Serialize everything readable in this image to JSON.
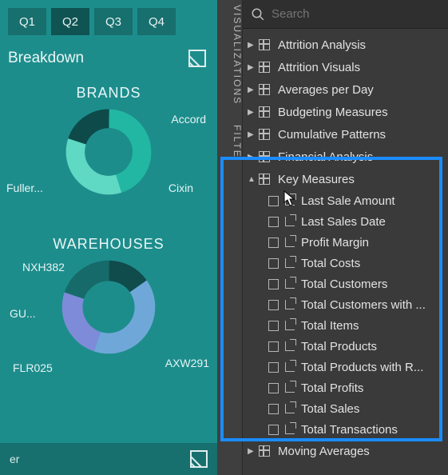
{
  "report": {
    "tabs": [
      "Q1",
      "Q2",
      "Q3",
      "Q4"
    ],
    "active_tab_index": 1,
    "breakdown_label": "Breakdown",
    "footer_label": "er",
    "brands": {
      "title": "BRANDS",
      "labels": {
        "top_right": "Accord",
        "left": "Fuller...",
        "bottom_right": "Cixin"
      }
    },
    "warehouses": {
      "title": "WAREHOUSES",
      "labels": {
        "top_left": "NXH382",
        "left": "GU...",
        "bottom_left": "FLR025",
        "bottom_right": "AXW291"
      }
    }
  },
  "chart_data": [
    {
      "type": "pie",
      "title": "BRANDS",
      "subtype": "donut",
      "series": [
        {
          "name": "Accord",
          "value": 45
        },
        {
          "name": "Cixin",
          "value": 35
        },
        {
          "name": "Fuller...",
          "value": 20
        }
      ]
    },
    {
      "type": "pie",
      "title": "WAREHOUSES",
      "subtype": "donut",
      "series": [
        {
          "name": "AXW291",
          "value": 40
        },
        {
          "name": "NXH382",
          "value": 25
        },
        {
          "name": "GU...",
          "value": 20
        },
        {
          "name": "FLR025",
          "value": 15
        }
      ]
    }
  ],
  "fields_panel": {
    "vertical_labels": {
      "top": "VISUALIZATIONS",
      "bottom": "FILTE"
    },
    "search_placeholder": "Search",
    "tables": [
      "Attrition Analysis",
      "Attrition Visuals",
      "Averages per Day",
      "Budgeting Measures",
      "Cumulative Patterns",
      "Financial Analysis"
    ],
    "expanded_table": "Key Measures",
    "measures": [
      "Last Sale Amount",
      "Last Sales Date",
      "Profit Margin",
      "Total Costs",
      "Total Customers",
      "Total Customers with ...",
      "Total Items",
      "Total Products",
      "Total Products with R...",
      "Total Profits",
      "Total Sales",
      "Total Transactions"
    ],
    "tables_after": [
      "Moving Averages"
    ]
  }
}
